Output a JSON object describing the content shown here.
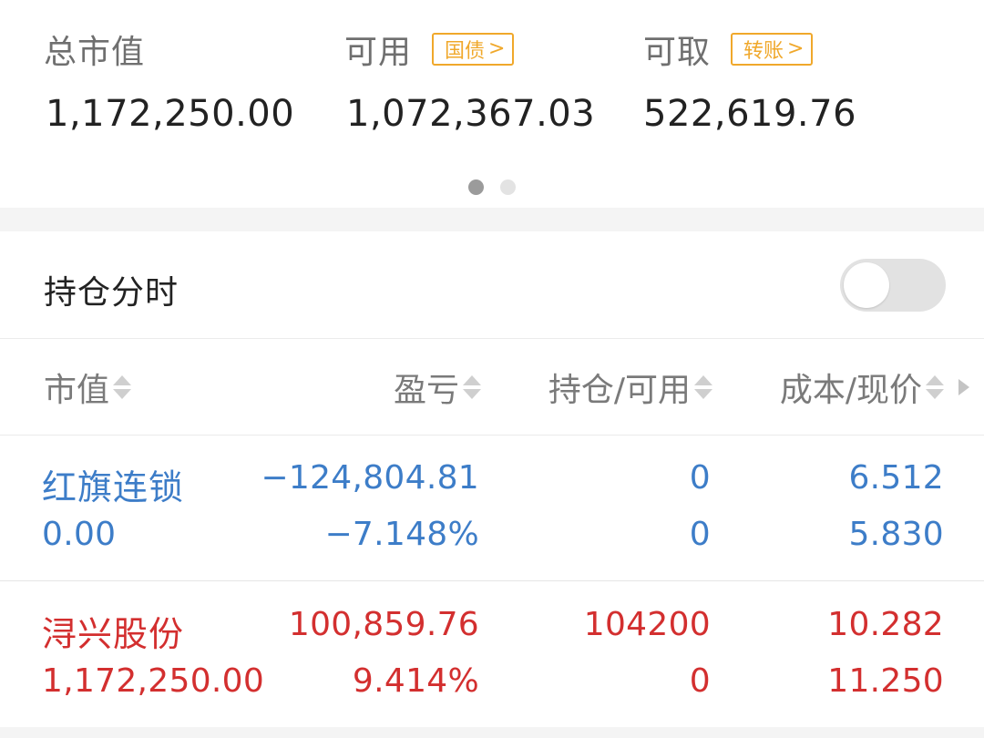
{
  "summary": {
    "total_market_value": {
      "label": "总市值",
      "value": "1,172,250.00"
    },
    "available": {
      "label": "可用",
      "tag": "国债",
      "value": "1,072,367.03"
    },
    "withdrawable": {
      "label": "可取",
      "tag": "转账",
      "value": "522,619.76"
    },
    "pager": {
      "count": 2,
      "active": 0
    }
  },
  "toggle": {
    "label": "持仓分时",
    "on": false
  },
  "table": {
    "headers": {
      "market_value": "市值",
      "profit_loss": "盈亏",
      "position_available": "持仓/可用",
      "cost_price": "成本/现价"
    },
    "rows": [
      {
        "name": "红旗连锁",
        "market_value": "0.00",
        "profit_loss": "−124,804.81",
        "profit_loss_pct": "−7.148%",
        "position": "0",
        "available": "0",
        "cost": "6.512",
        "price": "5.830",
        "color": "#3d7dc8"
      },
      {
        "name": "浔兴股份",
        "market_value": "1,172,250.00",
        "profit_loss": "100,859.76",
        "profit_loss_pct": "9.414%",
        "position": "104200",
        "available": "0",
        "cost": "10.282",
        "price": "11.250",
        "color": "#d32f2f"
      }
    ]
  },
  "colors": {
    "tag": "#f0a82b",
    "loss": "#3d7dc8",
    "gain": "#d32f2f",
    "label_gray": "#7a7a7a"
  },
  "icons": [
    "sort-icon",
    "chevron-right-icon",
    "scroll-right-arrow-icon",
    "page-indicator-dot"
  ]
}
